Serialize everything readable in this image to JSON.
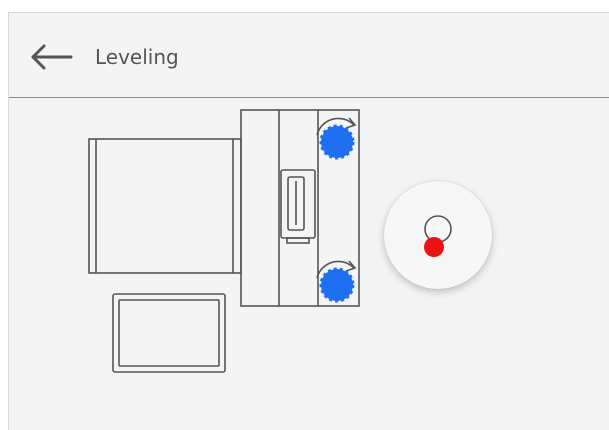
{
  "header": {
    "title": "Leveling",
    "back_icon": "arrow-left-icon"
  },
  "diagram": {
    "adjuster_feet": [
      {
        "name": "foot-top",
        "icon": "rotate-knob-icon",
        "color": "#1f6ff2"
      },
      {
        "name": "foot-bottom",
        "icon": "rotate-knob-icon",
        "color": "#1f6ff2"
      }
    ]
  },
  "level_indicator": {
    "icon": "bubble-level-icon",
    "target_ring_color": "#555555",
    "bubble_color": "#ee1111"
  },
  "colors": {
    "screen_bg": "#f4f4f4",
    "line": "#555555",
    "knob": "#1f6ff2",
    "bubble": "#ee1111"
  }
}
